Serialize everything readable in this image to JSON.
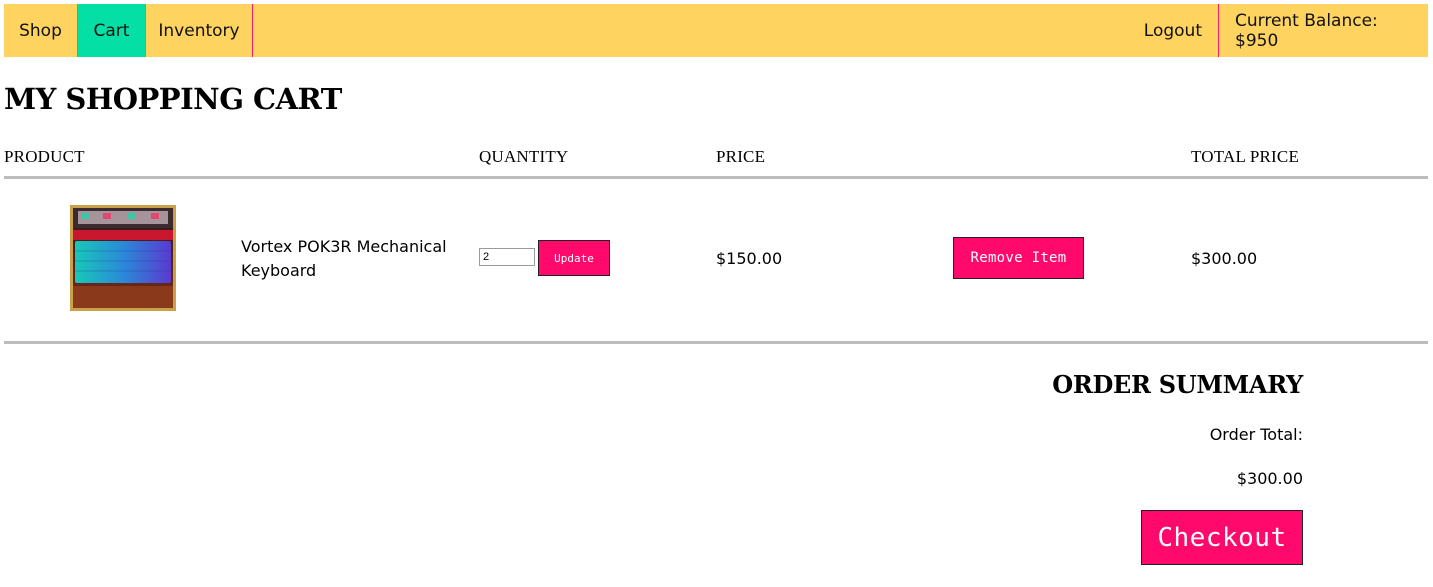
{
  "nav": {
    "shop": "Shop",
    "cart": "Cart",
    "inventory": "Inventory",
    "logout": "Logout",
    "balance": "Current Balance: $950"
  },
  "page_title": "MY SHOPPING CART",
  "columns": {
    "product": "PRODUCT",
    "quantity": "QUANTITY",
    "price": "PRICE",
    "total_price": "TOTAL PRICE"
  },
  "cart_items": [
    {
      "name": "Vortex POK3R Mechanical Keyboard",
      "image_icon": "keyboard-photo",
      "quantity": "2",
      "update_label": "Update",
      "price": "$150.00",
      "remove_label": "Remove Item",
      "total_price": "$300.00"
    }
  ],
  "summary": {
    "title": "ORDER SUMMARY",
    "order_total_label": "Order Total:",
    "order_total_value": "$300.00",
    "checkout_label": "Checkout"
  },
  "colors": {
    "nav_bg": "#fed35f",
    "nav_active": "#03dfa5",
    "button_bg": "#ff0a6c",
    "rule": "#bdbdbd"
  }
}
